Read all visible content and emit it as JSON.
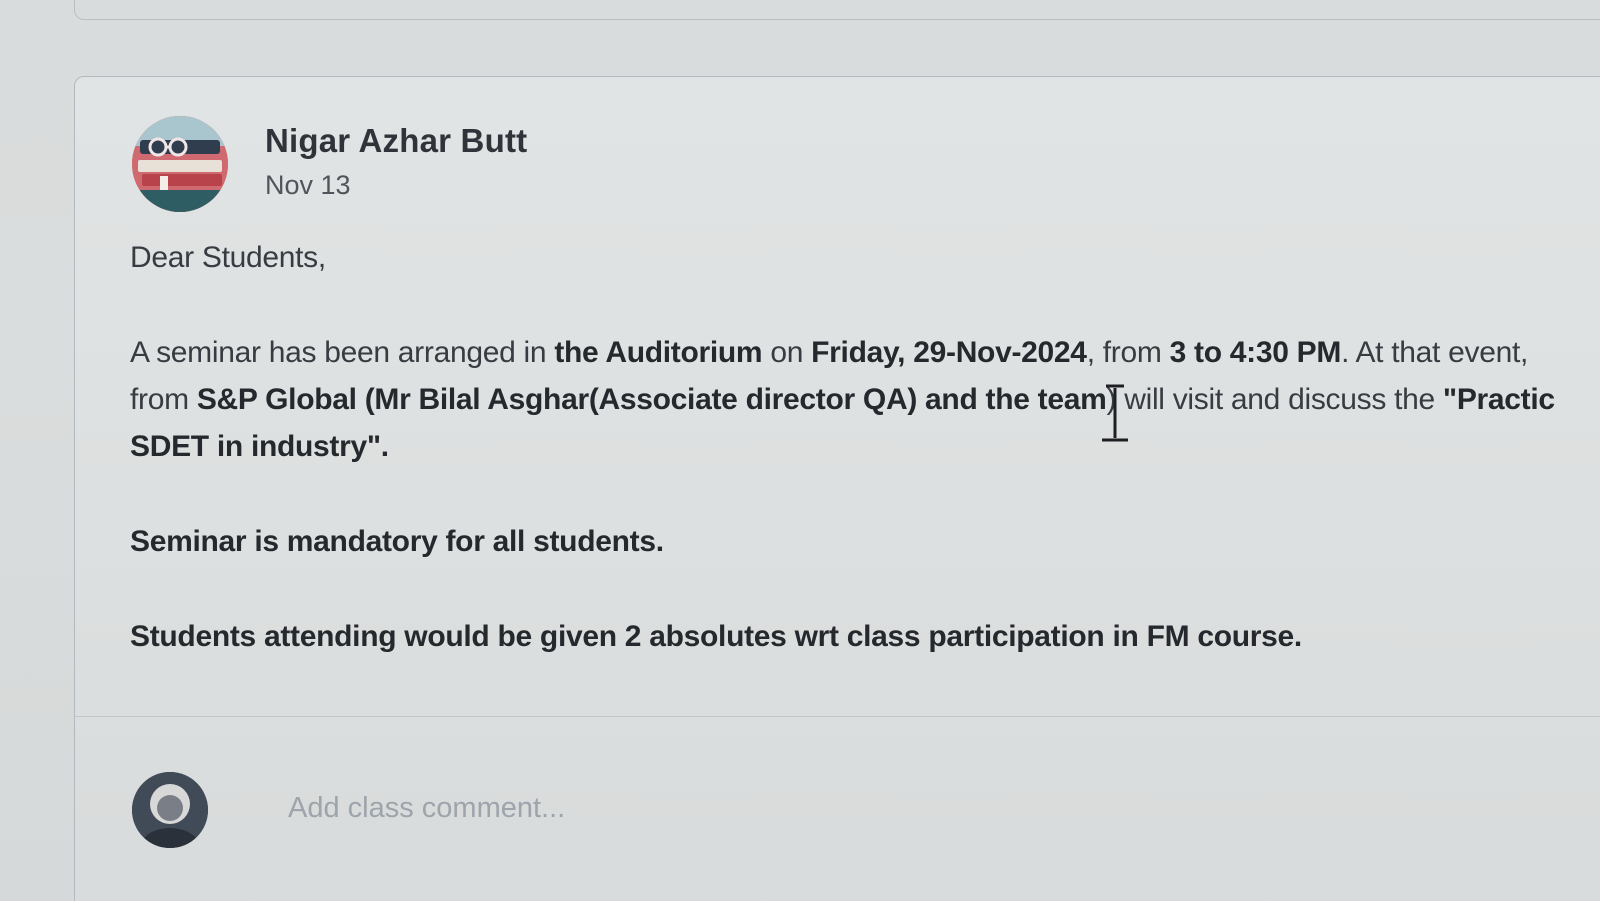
{
  "post": {
    "author": "Nigar Azhar Butt",
    "date": "Nov 13",
    "greeting": "Dear Students,",
    "paragraph1": {
      "t1": "A seminar has been arranged in ",
      "b1": "the Auditorium",
      "t2": " on ",
      "b2": "Friday, 29-Nov-2024",
      "t3": ", from ",
      "b3": "3 to 4:30 PM",
      "t4": ". At that event,",
      "t5": "from ",
      "b4": "S&P Global (Mr Bilal Asghar(Associate director QA) and the team",
      "t6": ") will visit and discuss the ",
      "b5": "\"Practic",
      "b6": "SDET in industry\"."
    },
    "paragraph2": "Seminar is mandatory for all students.",
    "paragraph3": "Students attending would be given 2 absolutes wrt class participation in FM course."
  },
  "comment": {
    "placeholder": "Add class comment..."
  },
  "colors": {
    "background": "#dadddd",
    "card_border": "#b3b9c1",
    "text": "#383c42",
    "placeholder": "#9ea4ab"
  },
  "icons": {
    "author_avatar": "books-avatar",
    "comment_avatar": "user-photo-avatar",
    "cursor": "text-cursor-icon"
  }
}
